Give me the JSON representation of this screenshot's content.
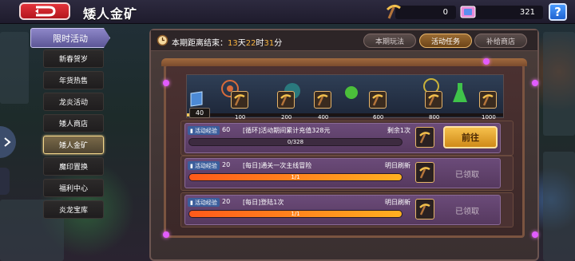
{
  "header": {
    "title": "矮人金矿",
    "currency_pick": "0",
    "currency_gem": "321",
    "help_label": "?"
  },
  "sidebar": {
    "title": "限时活动",
    "items": [
      {
        "label": "新春贺岁",
        "active": false
      },
      {
        "label": "年货热售",
        "active": false
      },
      {
        "label": "龙炎活动",
        "active": false
      },
      {
        "label": "矮人商店",
        "active": false
      },
      {
        "label": "矮人金矿",
        "active": true
      },
      {
        "label": "魔印置换",
        "active": false
      },
      {
        "label": "福利中心",
        "active": false
      },
      {
        "label": "炎龙宝库",
        "active": false
      }
    ]
  },
  "panel": {
    "countdown_prefix": "本期距离结束：",
    "days": "13",
    "days_unit": "天",
    "hours": "22",
    "hours_unit": "时",
    "minutes": "31",
    "minutes_unit": "分",
    "tabs": [
      {
        "label": "本期玩法",
        "active": false
      },
      {
        "label": "活动任务",
        "active": true
      },
      {
        "label": "补给商店",
        "active": false
      }
    ]
  },
  "milestones": {
    "start": "40",
    "current_fraction": 0.04,
    "ticks": [
      "100",
      "200",
      "400",
      "600",
      "800",
      "1000"
    ]
  },
  "tasks": [
    {
      "exp_label": "活动经验",
      "exp_value": "60",
      "name": "[循环]活动期间累计充值328元",
      "status": "剩余1次",
      "progress_text": "0/328",
      "progress_fraction": 0.0,
      "action": "前往",
      "claimed": false
    },
    {
      "exp_label": "活动经验",
      "exp_value": "20",
      "name": "[每日]通关一次主线冒险",
      "status": "明日刷新",
      "progress_text": "1/1",
      "progress_fraction": 1.0,
      "action": "已领取",
      "claimed": true
    },
    {
      "exp_label": "活动经验",
      "exp_value": "20",
      "name": "[每日]登陆1次",
      "status": "明日刷新",
      "progress_text": "1/1",
      "progress_fraction": 1.0,
      "action": "已领取",
      "claimed": true
    }
  ],
  "colors": {
    "accent_orange": "#f7b33d",
    "progress_fill": "#ff7a1c",
    "tab_active": "#9a6b33",
    "back_red": "#e2333a"
  }
}
